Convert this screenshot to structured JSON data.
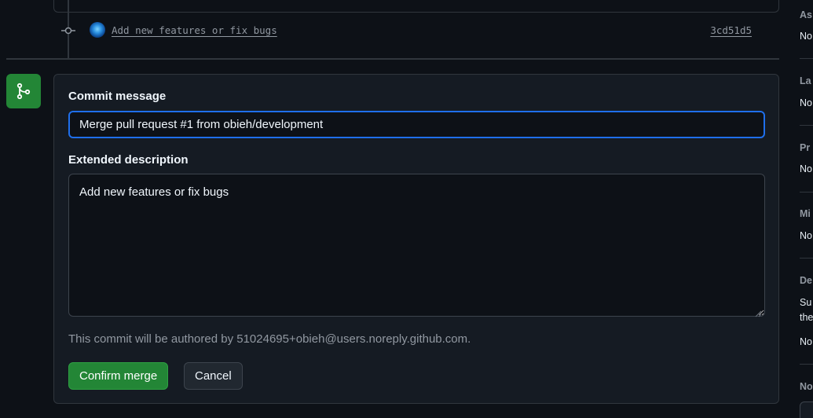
{
  "timeline": {
    "commit_message": "Add new features or fix bugs",
    "commit_sha": "3cd51d5"
  },
  "merge": {
    "commit_message_label": "Commit message",
    "commit_message_value": "Merge pull request #1 from obieh/development",
    "extended_description_label": "Extended description",
    "extended_description_value": "Add new features or fix bugs",
    "author_note": "This commit will be authored by 51024695+obieh@users.noreply.github.com.",
    "confirm_label": "Confirm merge",
    "cancel_label": "Cancel"
  },
  "sidebar": {
    "sections": [
      {
        "heading": "As",
        "value": "No"
      },
      {
        "heading": "La",
        "value": "No"
      },
      {
        "heading": "Pr",
        "value": "No"
      },
      {
        "heading": "Mi",
        "value": "No"
      },
      {
        "heading": "De",
        "lines": [
          "Su",
          "the"
        ],
        "value": "No"
      },
      {
        "heading": "No"
      }
    ]
  },
  "colors": {
    "background": "#0d1117",
    "accent_green": "#238636",
    "focus_blue": "#1f6feb",
    "muted_text": "#9198a1"
  },
  "icons": [
    "git-commit-icon",
    "git-merge-icon",
    "avatar"
  ]
}
